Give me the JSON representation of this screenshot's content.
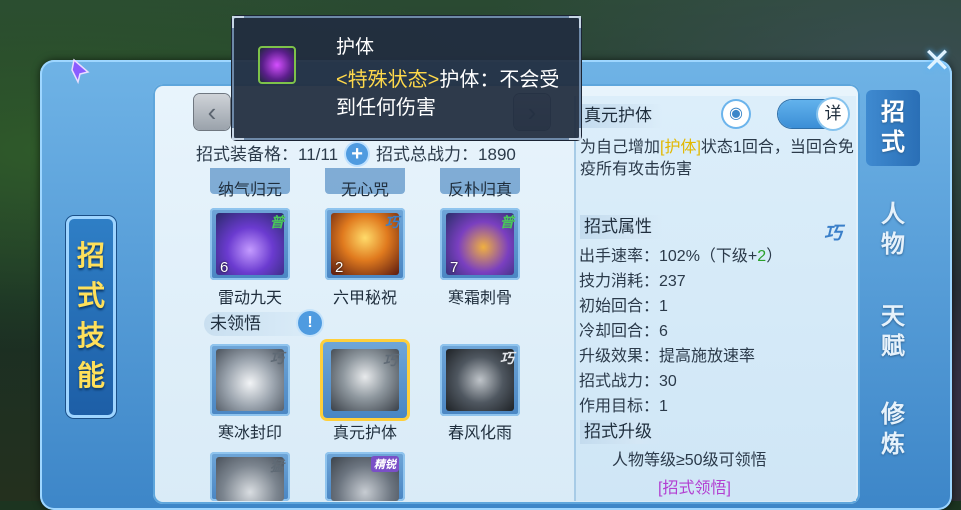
{
  "tooltip": {
    "title": "护体",
    "desc_tag": "<特殊状态>",
    "desc_text": "护体：不会受到任何伤害",
    "icon": "shield-skill-icon"
  },
  "left_panel": {
    "vertical_title": [
      "招",
      "式",
      "技",
      "能"
    ]
  },
  "side_tabs": [
    {
      "label": [
        "招",
        "式"
      ],
      "active": true
    },
    {
      "label": [
        "人",
        "物"
      ],
      "active": false
    },
    {
      "label": [
        "天",
        "赋"
      ],
      "active": false
    },
    {
      "label": [
        "修",
        "炼"
      ],
      "active": false
    }
  ],
  "counts": {
    "equip_label": "招式装备格：",
    "equip_value": "11/11",
    "power_label": "招式总战力：",
    "power_value": "1890"
  },
  "nav": {
    "prev": "‹",
    "next": "›"
  },
  "skills_top_row": [
    {
      "name": "纳气归元"
    },
    {
      "name": "无心咒"
    },
    {
      "name": "反朴归真"
    }
  ],
  "skills_learned": [
    {
      "name": "雷动九天",
      "grade": "普",
      "level": "6",
      "grade_color": "#49c85a"
    },
    {
      "name": "六甲秘祝",
      "grade": "巧",
      "level": "2",
      "grade_color": "#3a7fc9"
    },
    {
      "name": "寒霜刺骨",
      "grade": "普",
      "level": "7",
      "grade_color": "#49c85a"
    }
  ],
  "unlearned_label": "未领悟",
  "skills_unlearned": [
    {
      "name": "寒冰封印",
      "grade": "巧"
    },
    {
      "name": "真元护体",
      "grade": "巧",
      "selected": true
    },
    {
      "name": "春风化雨",
      "grade": "巧"
    }
  ],
  "skills_bottom_row": [
    {
      "grade": "猛"
    },
    {
      "grade": "精锐"
    }
  ],
  "detail": {
    "skill_name": "真元护体",
    "toggle_label": "详",
    "desc_pre": "为自己增加",
    "desc_tag": "[护体]",
    "desc_post": "状态1回合，当回合免疫所有攻击伤害",
    "attr_header": "招式属性",
    "grade_mark": "巧",
    "attrs": {
      "speed": "出手速率：102%（下级+",
      "speed_next": "2",
      "speed_end": "）",
      "cost": "技力消耗：237",
      "init_round": "初始回合：1",
      "cooldown": "冷却回合：6",
      "upgrade_effect": "升级效果：提高施放速率",
      "power": "招式战力：30",
      "target": "作用目标：1"
    },
    "upgrade_header": "招式升级",
    "upgrade_req": "人物等级≥50级可领悟",
    "learn_link": "[招式领悟]"
  },
  "colors": {
    "accent_blue": "#3d86c8",
    "highlight_yellow": "#ffd84a",
    "link_purple": "#b23fd1",
    "green": "#2aa02a"
  }
}
